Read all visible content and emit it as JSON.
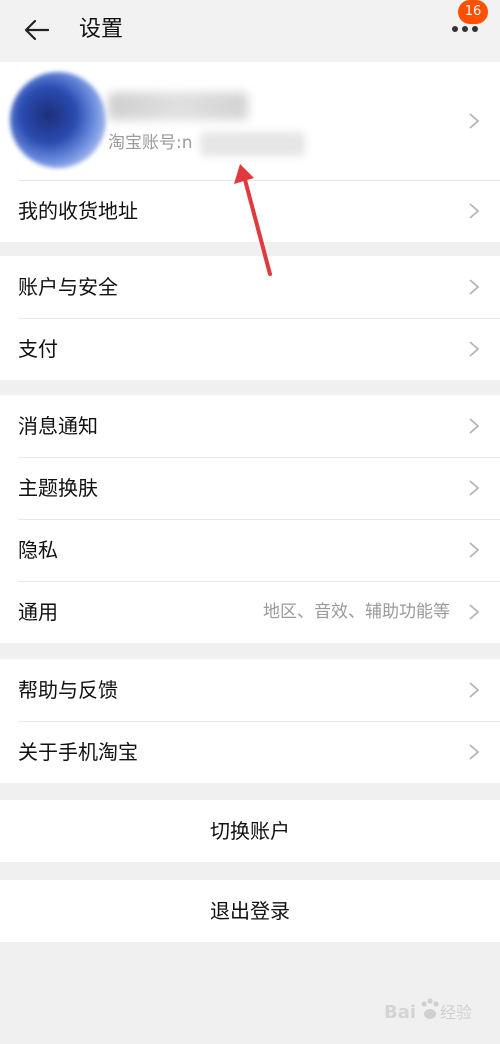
{
  "header": {
    "title": "设置",
    "badge_count": "16"
  },
  "profile": {
    "account_prefix": "淘宝账号:n"
  },
  "groups": [
    {
      "items": [
        {
          "label": "我的收货地址"
        }
      ]
    },
    {
      "items": [
        {
          "label": "账户与安全"
        },
        {
          "label": "支付"
        }
      ]
    },
    {
      "items": [
        {
          "label": "消息通知"
        },
        {
          "label": "主题换肤"
        },
        {
          "label": "隐私"
        },
        {
          "label": "通用",
          "hint": "地区、音效、辅助功能等"
        }
      ]
    },
    {
      "items": [
        {
          "label": "帮助与反馈"
        },
        {
          "label": "关于手机淘宝"
        }
      ]
    }
  ],
  "actions": {
    "switch_account": "切换账户",
    "logout": "退出登录"
  },
  "colors": {
    "badge": "#ff5000",
    "annotation_arrow": "#e0393e"
  }
}
